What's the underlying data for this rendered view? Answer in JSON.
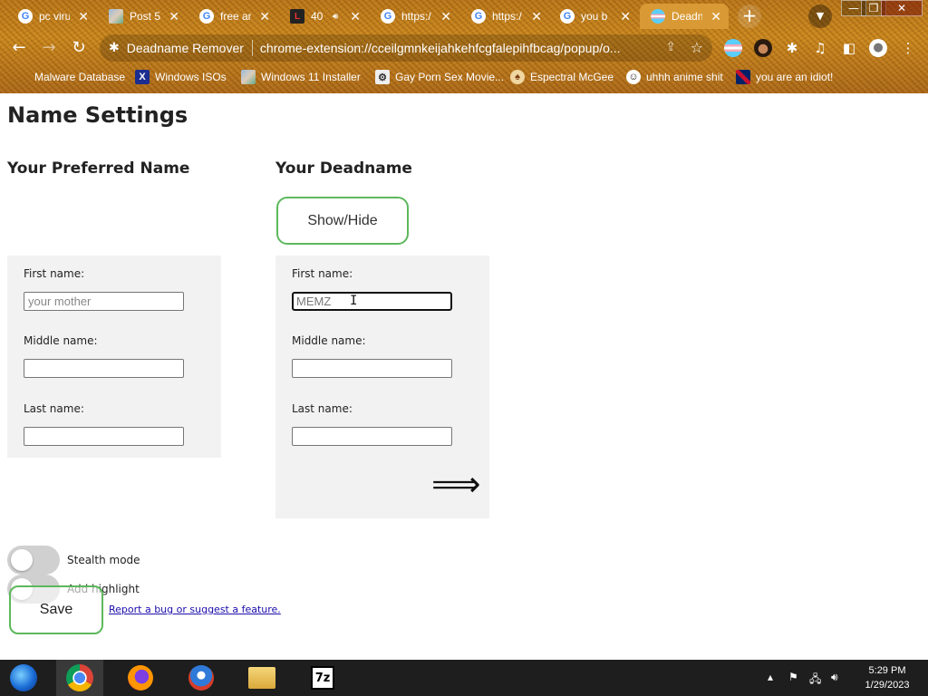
{
  "browser": {
    "tabs": [
      {
        "title": "pc viru",
        "icon": "google-icon"
      },
      {
        "title": "Post 5",
        "icon": "image-icon"
      },
      {
        "title": "free ar",
        "icon": "google-icon"
      },
      {
        "title": "40",
        "icon": "letter-l-icon"
      },
      {
        "title": "https:/",
        "icon": "google-icon"
      },
      {
        "title": "https:/",
        "icon": "google-icon"
      },
      {
        "title": "you b",
        "icon": "google-icon"
      },
      {
        "title": "Deadn",
        "icon": "trans-flag-icon",
        "active": true
      }
    ],
    "omnibox": {
      "extension_name": "Deadname Remover",
      "url": "chrome-extension://cceilgmnkeijahkehfcgfalepihfbcag/popup/o..."
    },
    "bookmarks": [
      {
        "label": "Malware Database",
        "icon": "blank-icon"
      },
      {
        "label": "Windows ISOs",
        "icon": "x-logo-icon"
      },
      {
        "label": "Windows 11 Installer",
        "icon": "image-icon"
      },
      {
        "label": "Gay Porn Sex Movie...",
        "icon": "gear-icon"
      },
      {
        "label": "Espectral McGee",
        "icon": "mushroom-icon"
      },
      {
        "label": "uhhh anime shit",
        "icon": "anime-face-icon"
      },
      {
        "label": "you are an idiot!",
        "icon": "uk-flag-icon"
      }
    ]
  },
  "page": {
    "title": "Name Settings",
    "preferred": {
      "heading": "Your Preferred Name",
      "first_label": "First name:",
      "first_placeholder": "your mother",
      "first_value": "",
      "middle_label": "Middle name:",
      "middle_value": "",
      "last_label": "Last name:",
      "last_value": ""
    },
    "deadname": {
      "heading": "Your Deadname",
      "show_hide_label": "Show/Hide",
      "first_label": "First name:",
      "first_value": "MEMZ",
      "middle_label": "Middle name:",
      "middle_value": "",
      "last_label": "Last name:",
      "last_value": "",
      "arrow": "⟹"
    },
    "toggles": {
      "stealth_label": "Stealth mode",
      "stealth_on": false,
      "highlight_label": "Add highlight",
      "highlight_on": false
    },
    "save_label": "Save",
    "report_link": "Report a bug or suggest a feature."
  },
  "taskbar": {
    "time": "5:29 PM",
    "date": "1/29/2023",
    "zip_label": "7z"
  }
}
